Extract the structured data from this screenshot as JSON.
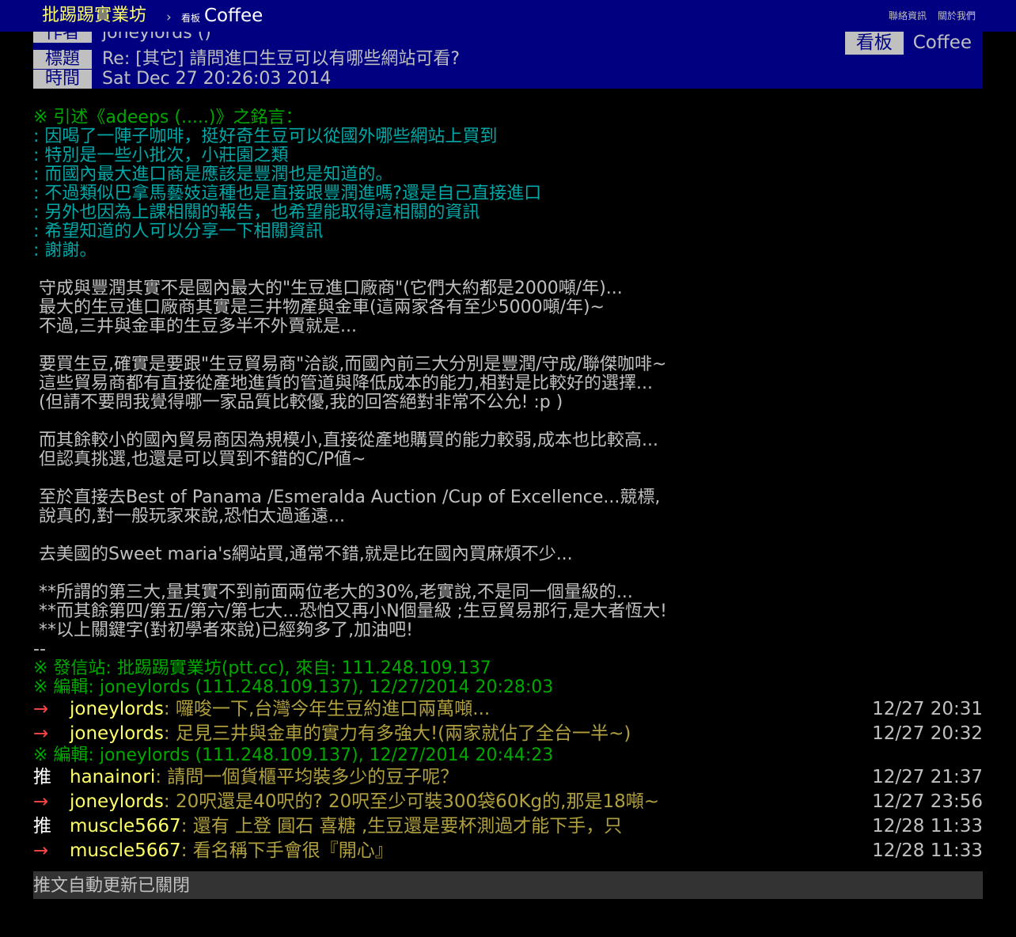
{
  "topbar": {
    "site_title": "批踢踢實業坊",
    "separator": "›",
    "board_label": "看板",
    "board_name": "Coffee",
    "links": [
      "聯絡資訊",
      "關於我們"
    ]
  },
  "header": {
    "author_label": "作者",
    "author_value": "joneylords ()",
    "board_label": "看板",
    "board_value": "Coffee",
    "title_label": "標題",
    "title_value": "Re: [其它] 請問進口生豆可以有哪些網站可看?",
    "time_label": "時間",
    "time_value": "Sat Dec 27 20:26:03 2014"
  },
  "quote": {
    "header": "※ 引述《adeeps (.....)》之銘言：",
    "lines": [
      ": 因喝了一陣子咖啡，挺好奇生豆可以從國外哪些網站上買到",
      ": 特別是一些小批次，小莊園之類",
      ": 而國內最大進口商是應該是豐潤也是知道的。",
      ": 不過類似巴拿馬藝妓這種也是直接跟豐潤進嗎?還是自己直接進口",
      ": 另外也因為上課相關的報告，也希望能取得這相關的資訊",
      ": 希望知道的人可以分享一下相關資訊",
      ": 謝謝。"
    ]
  },
  "body": {
    "lines": [
      "",
      " 守成與豐潤其實不是國內最大的\"生豆進口廠商\"(它們大約都是2000噸/年)...",
      " 最大的生豆進口廠商其實是三井物產與金車(這兩家各有至少5000噸/年)~",
      " 不過,三井與金車的生豆多半不外賣就是...",
      "",
      " 要買生豆,確實是要跟\"生豆貿易商\"洽談,而國內前三大分別是豐潤/守成/聯傑咖啡~",
      " 這些貿易商都有直接從產地進貨的管道與降低成本的能力,相對是比較好的選擇...",
      " (但請不要問我覺得哪一家品質比較優,我的回答絕對非常不公允! :p )",
      "",
      " 而其餘較小的國內貿易商因為規模小,直接從產地購買的能力較弱,成本也比較高...",
      " 但認真挑選,也還是可以買到不錯的C/P値~",
      "",
      " 至於直接去Best of Panama /Esmeralda Auction /Cup of Excellence...競標,",
      " 說真的,對一般玩家來說,恐怕太過遙遠...",
      "",
      " 去美國的Sweet maria's網站買,通常不錯,就是比在國內買麻煩不少...",
      "",
      " **所謂的第三大,量其實不到前面兩位老大的30%,老實說,不是同一個量級的...",
      " **而其餘第四/第五/第六/第七大...恐怕又再小N個量級 ;生豆貿易那行,是大者恆大!",
      " **以上關鍵字(對初學者來說)已經夠多了,加油吧!",
      "--"
    ]
  },
  "signature": {
    "lines": [
      "※ 發信站: 批踢踢實業坊(ptt.cc), 來自: 111.248.109.137",
      "※ 編輯: joneylords (111.248.109.137), 12/27/2014 20:28:03"
    ]
  },
  "pushes_a": [
    {
      "tag": "→",
      "kind": "arrow",
      "user": "joneylords",
      "content": ": 囉唆一下,台灣今年生豆約進口兩萬噸...",
      "time": "12/27 20:31"
    },
    {
      "tag": "→",
      "kind": "arrow",
      "user": "joneylords",
      "content": ": 足見三井與金車的實力有多強大!(兩家就佔了全台一半~)",
      "time": "12/27 20:32"
    }
  ],
  "edit_line": "※ 編輯: joneylords (111.248.109.137), 12/27/2014 20:44:23",
  "pushes_b": [
    {
      "tag": "推",
      "kind": "good",
      "user": "hanainori",
      "content": ": 請問一個貨櫃平均裝多少的豆子呢？",
      "time": "12/27 21:37"
    },
    {
      "tag": "→",
      "kind": "arrow",
      "user": "joneylords",
      "content": ": 20呎還是40呎的? 20呎至少可裝300袋60Kg的,那是18噸~",
      "time": "12/27 23:56"
    },
    {
      "tag": "推",
      "kind": "good",
      "user": "muscle5667",
      "content": ": 還有 上登  圓石 喜糖 ,生豆還是要杯測過才能下手，只",
      "time": "12/28 11:33"
    },
    {
      "tag": "→",
      "kind": "arrow",
      "user": "muscle5667",
      "content": ": 看名稱下手會很『開心』",
      "time": "12/28 11:33"
    }
  ],
  "footer": {
    "autoupdate": "推文自動更新已關閉"
  }
}
